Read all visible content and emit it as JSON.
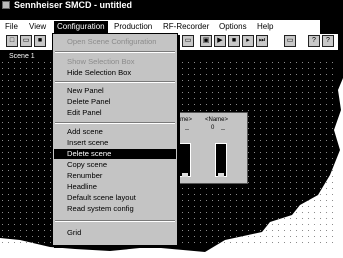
{
  "window": {
    "title": "Sennheiser SMCD - untitled"
  },
  "menubar": {
    "items": [
      {
        "label": "File",
        "active": false
      },
      {
        "label": "View",
        "active": false
      },
      {
        "label": "Configuration",
        "active": true
      },
      {
        "label": "Production",
        "active": false
      },
      {
        "label": "RF-Recorder",
        "active": false
      },
      {
        "label": "Options",
        "active": false
      },
      {
        "label": "Help",
        "active": false
      }
    ]
  },
  "scene_tab": {
    "label": "Scene 1"
  },
  "panel": {
    "channels": [
      {
        "name": "<Name>",
        "value": "0",
        "value2": "--",
        "meter_label": "»"
      },
      {
        "name": "<Name>",
        "value": "0",
        "value2": "--",
        "meter_label": "»"
      }
    ]
  },
  "configuration_menu": {
    "items": [
      {
        "label": "Open Scene Configuration",
        "disabled": true
      },
      {
        "label": "Show Selection Box",
        "disabled": true
      },
      {
        "label": "Hide Selection Box",
        "disabled": false
      },
      {
        "label": "New Panel",
        "disabled": false
      },
      {
        "label": "Delete Panel",
        "disabled": false
      },
      {
        "label": "Edit Panel",
        "disabled": false
      },
      {
        "label": "Add scene",
        "disabled": false
      },
      {
        "label": "Insert scene",
        "disabled": false
      },
      {
        "label": "Delete scene",
        "disabled": false,
        "highlighted": true
      },
      {
        "label": "Copy scene",
        "disabled": false
      },
      {
        "label": "Renumber",
        "disabled": false
      },
      {
        "label": "Headline",
        "disabled": false
      },
      {
        "label": "Default scene layout",
        "disabled": false
      },
      {
        "label": "Read system config",
        "disabled": false
      },
      {
        "label": "Grid",
        "disabled": false
      }
    ]
  },
  "colors": {
    "menu_bg": "#c4c4c4",
    "highlight": "#000000",
    "disabled_text": "#8c8c8c"
  }
}
